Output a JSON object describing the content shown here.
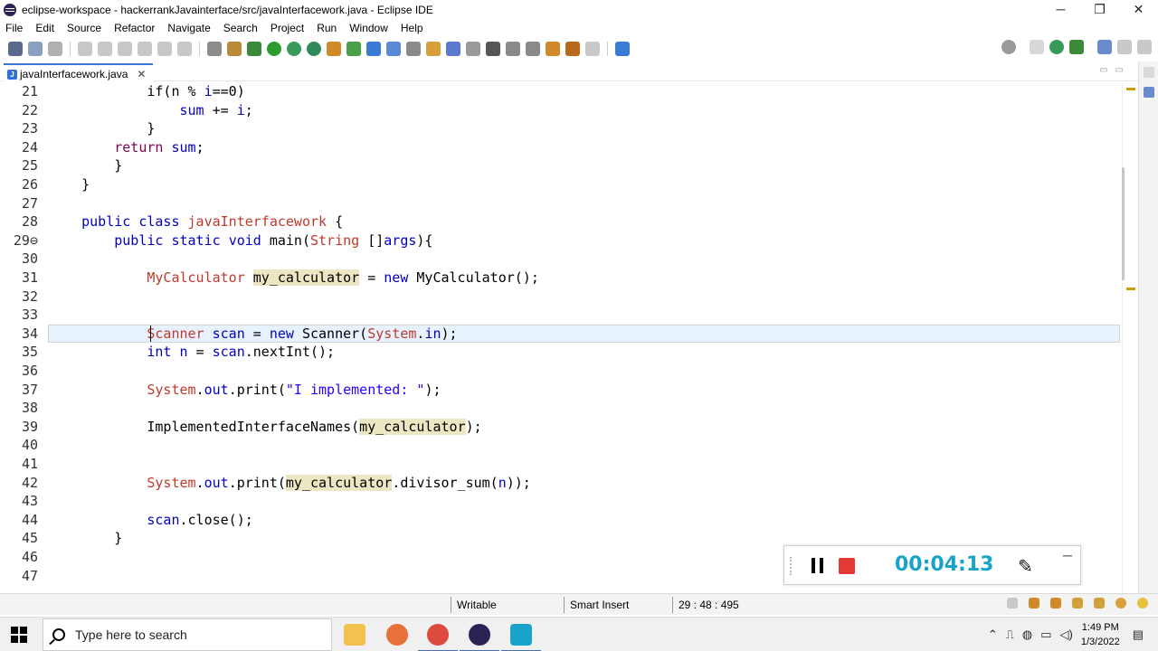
{
  "window": {
    "title": "eclipse-workspace - hackerrankJavainterface/src/javaInterfacework.java - Eclipse IDE",
    "controls": [
      "─",
      "❐",
      "✕"
    ]
  },
  "menu": [
    "File",
    "Edit",
    "Source",
    "Refactor",
    "Navigate",
    "Search",
    "Project",
    "Run",
    "Window",
    "Help"
  ],
  "editor": {
    "tab_label": "javaInterfacework.java",
    "tab_close": "✕",
    "lines": [
      {
        "n": "21",
        "segs": [
          {
            "t": "            if(n % ",
            "c": ""
          },
          {
            "t": "i",
            "c": "fld"
          },
          {
            "t": "==0)",
            "c": ""
          }
        ]
      },
      {
        "n": "22",
        "segs": [
          {
            "t": "                ",
            "c": ""
          },
          {
            "t": "sum",
            "c": "fld"
          },
          {
            "t": " += ",
            "c": ""
          },
          {
            "t": "i",
            "c": "fld"
          },
          {
            "t": ";",
            "c": ""
          }
        ]
      },
      {
        "n": "23",
        "segs": [
          {
            "t": "            }",
            "c": ""
          }
        ]
      },
      {
        "n": "24",
        "segs": [
          {
            "t": "        ",
            "c": ""
          },
          {
            "t": "return",
            "c": "kw"
          },
          {
            "t": " ",
            "c": ""
          },
          {
            "t": "sum",
            "c": "fld"
          },
          {
            "t": ";",
            "c": ""
          }
        ]
      },
      {
        "n": "25",
        "segs": [
          {
            "t": "        }",
            "c": ""
          }
        ]
      },
      {
        "n": "26",
        "segs": [
          {
            "t": "    }",
            "c": ""
          }
        ]
      },
      {
        "n": "27",
        "segs": []
      },
      {
        "n": "28",
        "segs": [
          {
            "t": "    ",
            "c": ""
          },
          {
            "t": "public",
            "c": "kw2"
          },
          {
            "t": " ",
            "c": ""
          },
          {
            "t": "class",
            "c": "kw2"
          },
          {
            "t": " ",
            "c": ""
          },
          {
            "t": "javaInterfacework",
            "c": "cls"
          },
          {
            "t": " {",
            "c": ""
          }
        ]
      },
      {
        "n": "29⊖",
        "segs": [
          {
            "t": "        ",
            "c": ""
          },
          {
            "t": "public",
            "c": "kw2"
          },
          {
            "t": " ",
            "c": ""
          },
          {
            "t": "static",
            "c": "kw2"
          },
          {
            "t": " ",
            "c": ""
          },
          {
            "t": "void",
            "c": "kw2"
          },
          {
            "t": " main(",
            "c": ""
          },
          {
            "t": "String",
            "c": "cls"
          },
          {
            "t": " []",
            "c": ""
          },
          {
            "t": "args",
            "c": "fld"
          },
          {
            "t": "){",
            "c": ""
          }
        ]
      },
      {
        "n": "30",
        "segs": []
      },
      {
        "n": "31",
        "segs": [
          {
            "t": "            ",
            "c": ""
          },
          {
            "t": "MyCalculator",
            "c": "cls"
          },
          {
            "t": " ",
            "c": ""
          },
          {
            "t": "my_calculator",
            "c": "hl"
          },
          {
            "t": " = ",
            "c": ""
          },
          {
            "t": "new",
            "c": "kw2"
          },
          {
            "t": " MyCalculator();",
            "c": ""
          }
        ]
      },
      {
        "n": "32",
        "segs": []
      },
      {
        "n": "33",
        "segs": []
      },
      {
        "n": "34",
        "segs": [
          {
            "t": "            ",
            "c": ""
          },
          {
            "t": "Scanner",
            "c": "cls"
          },
          {
            "t": " ",
            "c": ""
          },
          {
            "t": "scan",
            "c": "fld"
          },
          {
            "t": " = ",
            "c": ""
          },
          {
            "t": "new",
            "c": "kw2"
          },
          {
            "t": " Scanner(",
            "c": ""
          },
          {
            "t": "System",
            "c": "cls"
          },
          {
            "t": ".",
            "c": ""
          },
          {
            "t": "in",
            "c": "fld"
          },
          {
            "t": ");",
            "c": ""
          }
        ]
      },
      {
        "n": "35",
        "segs": [
          {
            "t": "            ",
            "c": ""
          },
          {
            "t": "int",
            "c": "kw2"
          },
          {
            "t": " ",
            "c": ""
          },
          {
            "t": "n",
            "c": "fld"
          },
          {
            "t": " = ",
            "c": ""
          },
          {
            "t": "scan",
            "c": "fld"
          },
          {
            "t": ".nextInt();",
            "c": ""
          }
        ]
      },
      {
        "n": "36",
        "segs": []
      },
      {
        "n": "37",
        "segs": [
          {
            "t": "            ",
            "c": ""
          },
          {
            "t": "System",
            "c": "cls"
          },
          {
            "t": ".",
            "c": ""
          },
          {
            "t": "out",
            "c": "fld"
          },
          {
            "t": ".print(",
            "c": ""
          },
          {
            "t": "\"I implemented: \"",
            "c": "strc"
          },
          {
            "t": ");",
            "c": ""
          }
        ]
      },
      {
        "n": "38",
        "segs": []
      },
      {
        "n": "39",
        "segs": [
          {
            "t": "            ImplementedInterfaceNames(",
            "c": ""
          },
          {
            "t": "my_calculator",
            "c": "hl"
          },
          {
            "t": ");",
            "c": ""
          }
        ]
      },
      {
        "n": "40",
        "segs": []
      },
      {
        "n": "41",
        "segs": []
      },
      {
        "n": "42",
        "segs": [
          {
            "t": "            ",
            "c": ""
          },
          {
            "t": "System",
            "c": "cls"
          },
          {
            "t": ".",
            "c": ""
          },
          {
            "t": "out",
            "c": "fld"
          },
          {
            "t": ".print(",
            "c": ""
          },
          {
            "t": "my_calculator",
            "c": "hl"
          },
          {
            "t": ".divisor_sum(",
            "c": ""
          },
          {
            "t": "n",
            "c": "fld"
          },
          {
            "t": "));",
            "c": ""
          }
        ]
      },
      {
        "n": "43",
        "segs": []
      },
      {
        "n": "44",
        "segs": [
          {
            "t": "            ",
            "c": ""
          },
          {
            "t": "scan",
            "c": "fld"
          },
          {
            "t": ".close();",
            "c": ""
          }
        ]
      },
      {
        "n": "45",
        "segs": [
          {
            "t": "        }",
            "c": ""
          }
        ]
      },
      {
        "n": "46",
        "segs": []
      },
      {
        "n": "47",
        "segs": []
      }
    ],
    "current_line": "34"
  },
  "status": {
    "writable": "Writable",
    "insert_mode": "Smart Insert",
    "position": "29 : 48 : 495"
  },
  "recorder": {
    "time": "00:04:13",
    "minimize": "─"
  },
  "taskbar": {
    "search_placeholder": "Type here to search",
    "time": "1:49 PM",
    "date": "1/3/2022"
  },
  "colors": {
    "keyword": "#7f0055",
    "type": "#c0392b",
    "field": "#0000c0",
    "string": "#2a00ff",
    "occurrence_highlight": "#ece6c2",
    "recorder_time": "#1aa3c9",
    "recorder_stop": "#e53935"
  }
}
